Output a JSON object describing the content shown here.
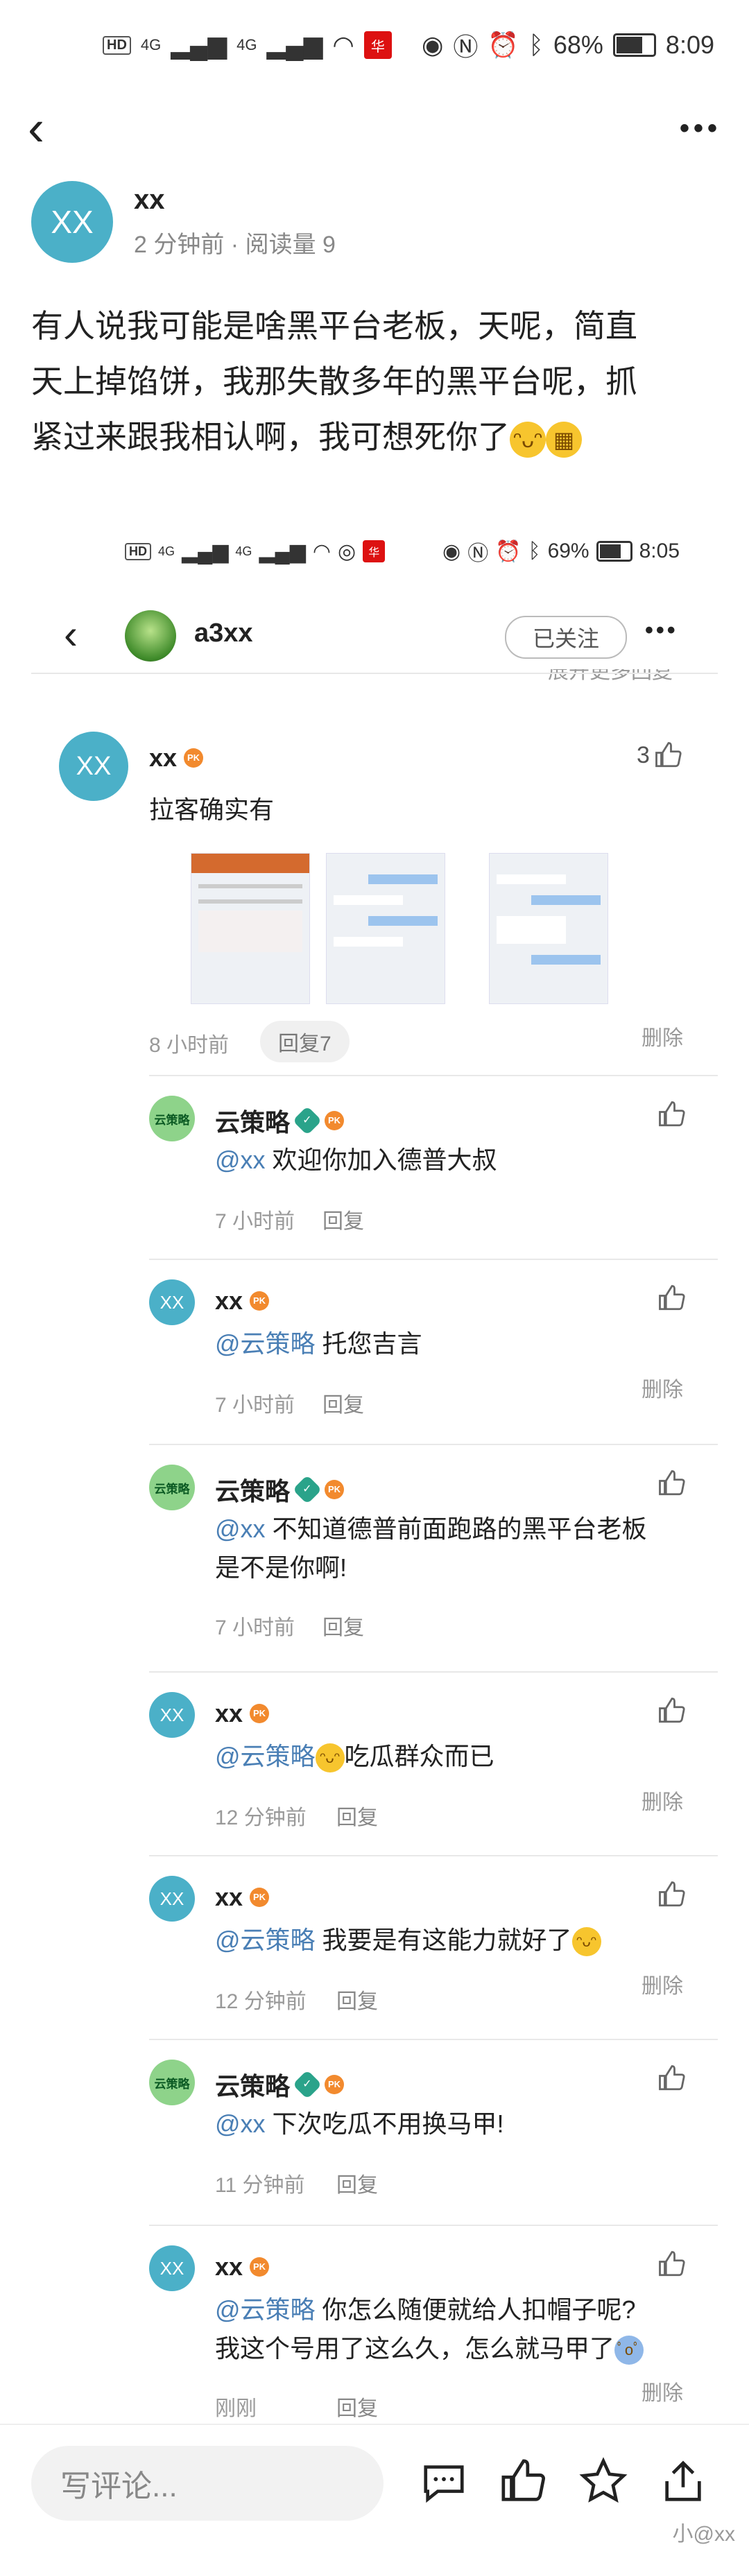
{
  "status_bar": {
    "left_badge": "HD",
    "signal1": "4G",
    "signal2": "4G",
    "battery": "68%",
    "time": "8:09"
  },
  "author": {
    "avatar_text": "XX",
    "name": "xx",
    "meta": "2 分钟前 · 阅读量 9"
  },
  "post": {
    "line1": "有人说我可能是啥黑平台老板，天呢，简直",
    "line2": "天上掉馅饼，我那失散多年的黑平台呢，抓",
    "line3": "紧过来跟我相认啊，我可想死你了"
  },
  "embed": {
    "status": {
      "badge": "HD",
      "signal1": "4G",
      "signal2": "4G",
      "battery": "69%",
      "time": "8:05"
    },
    "nav": {
      "username": "a3xx",
      "follow_label": "已关注"
    },
    "cut_text": "展开更多回复",
    "main_comment": {
      "avatar_text": "XX",
      "name": "xx",
      "text": "拉客确实有",
      "time": "8 小时前",
      "reply_btn": "回复7",
      "likes": "3",
      "delete": "删除"
    },
    "replies": [
      {
        "avatar": "云策略",
        "name": "云策略",
        "mention": "@xx",
        "text": " 欢迎你加入德普大叔",
        "text2": "",
        "time": "7 小时前",
        "reply": "回复",
        "delete": ""
      },
      {
        "avatar": "XX",
        "name": "xx",
        "mention": "@云策略",
        "text": " 托您吉言",
        "text2": "",
        "time": "7 小时前",
        "reply": "回复",
        "delete": "删除"
      },
      {
        "avatar": "云策略",
        "name": "云策略",
        "mention": "@xx",
        "text": " 不知道德普前面跑路的黑平台老板",
        "text2": "是不是你啊!",
        "time": "7 小时前",
        "reply": "回复",
        "delete": ""
      },
      {
        "avatar": "XX",
        "name": "xx",
        "mention": "@云策略",
        "text": "吃瓜群众而已",
        "text2": "",
        "time": "12 分钟前",
        "reply": "回复",
        "delete": "删除"
      },
      {
        "avatar": "XX",
        "name": "xx",
        "mention": "@云策略",
        "text": " 我要是有这能力就好了",
        "text2": "",
        "time": "12 分钟前",
        "reply": "回复",
        "delete": "删除"
      },
      {
        "avatar": "云策略",
        "name": "云策略",
        "mention": "@xx",
        "text": " 下次吃瓜不用换马甲!",
        "text2": "",
        "time": "11 分钟前",
        "reply": "回复",
        "delete": ""
      },
      {
        "avatar": "XX",
        "name": "xx",
        "mention": "@云策略",
        "text": " 你怎么随便就给人扣帽子呢?",
        "text2": "我这个号用了这么久，怎么就马甲了",
        "time": "刚刚",
        "reply": "回复",
        "delete": "删除"
      }
    ]
  },
  "bottom": {
    "input_placeholder": "写评论...",
    "watermark": "小@xx"
  },
  "icons": {
    "back": "chevron-left-icon",
    "more": "more-dots-icon",
    "comment": "comment-icon",
    "like": "thumbs-up-icon",
    "star": "star-icon",
    "share": "share-icon"
  }
}
